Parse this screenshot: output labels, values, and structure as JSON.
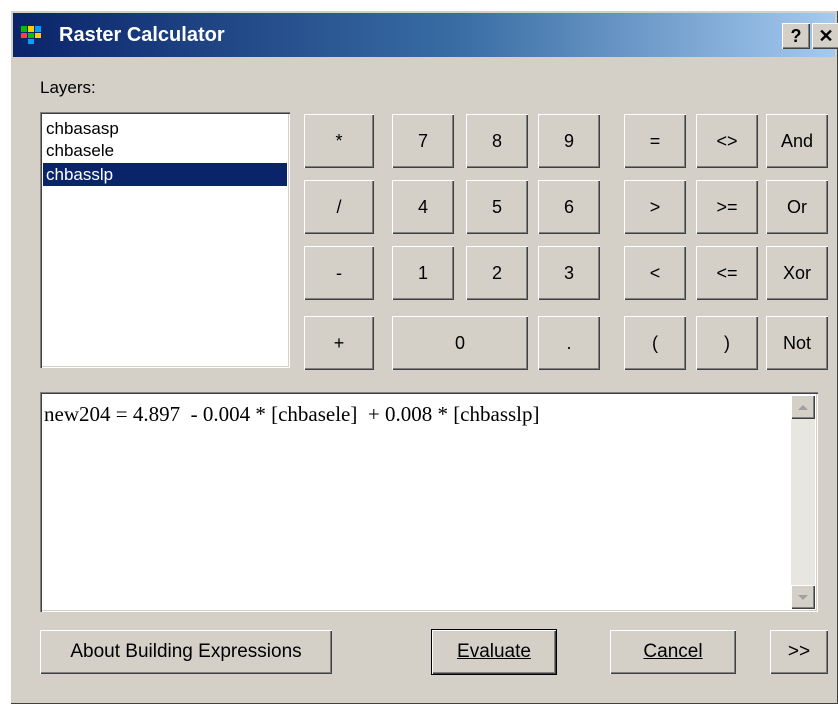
{
  "window": {
    "title": "Raster Calculator",
    "help_label": "?",
    "close_label": "✕"
  },
  "layers": {
    "label": "Layers:",
    "items": [
      "chbasasp",
      "chbasele",
      "chbasslp"
    ],
    "selected_index": 2
  },
  "keypad": {
    "ops": [
      "*",
      "/",
      "-",
      "+"
    ],
    "digits_row1": [
      "7",
      "8",
      "9"
    ],
    "digits_row2": [
      "4",
      "5",
      "6"
    ],
    "digits_row3": [
      "1",
      "2",
      "3"
    ],
    "zero": "0",
    "dot": ".",
    "compare_row1": [
      "=",
      "<>",
      "And"
    ],
    "compare_row2": [
      ">",
      ">=",
      "Or"
    ],
    "compare_row3": [
      "<",
      "<=",
      "Xor"
    ],
    "compare_row4": [
      "(",
      ")",
      "Not"
    ]
  },
  "expression": {
    "value": "new204 = 4.897  - 0.004 * [chbasele]  + 0.008 * [chbasslp]"
  },
  "footer": {
    "about_label": "About Building Expressions",
    "evaluate_label": "Evaluate",
    "cancel_label": "Cancel",
    "more_label": ">>"
  },
  "colors": {
    "face": "#d4d0c8",
    "selection": "#0a246a",
    "title_start": "#0a246a",
    "title_end": "#a6caf0"
  }
}
